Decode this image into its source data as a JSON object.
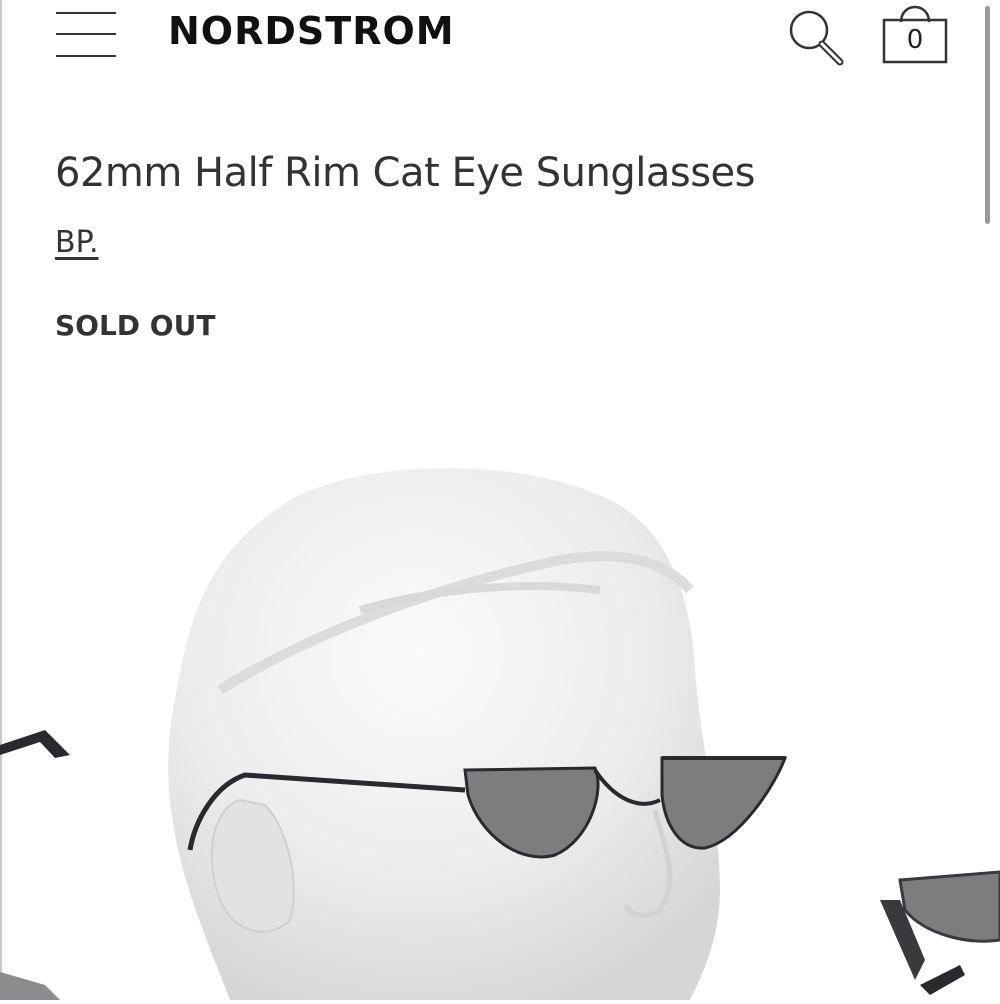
{
  "header": {
    "logo": "NORDSTROM",
    "bag_count": "0",
    "icons": {
      "menu": "hamburger-menu-icon",
      "search": "search-icon",
      "bag": "shopping-bag-icon"
    }
  },
  "product": {
    "title": "62mm Half Rim Cat Eye Sunglasses",
    "brand": "BP.",
    "status": "SOLD OUT"
  },
  "colors": {
    "text": "#333333",
    "lens": "#7d7d80",
    "frame": "#2a2a2e",
    "mannequin": "#efefef"
  }
}
